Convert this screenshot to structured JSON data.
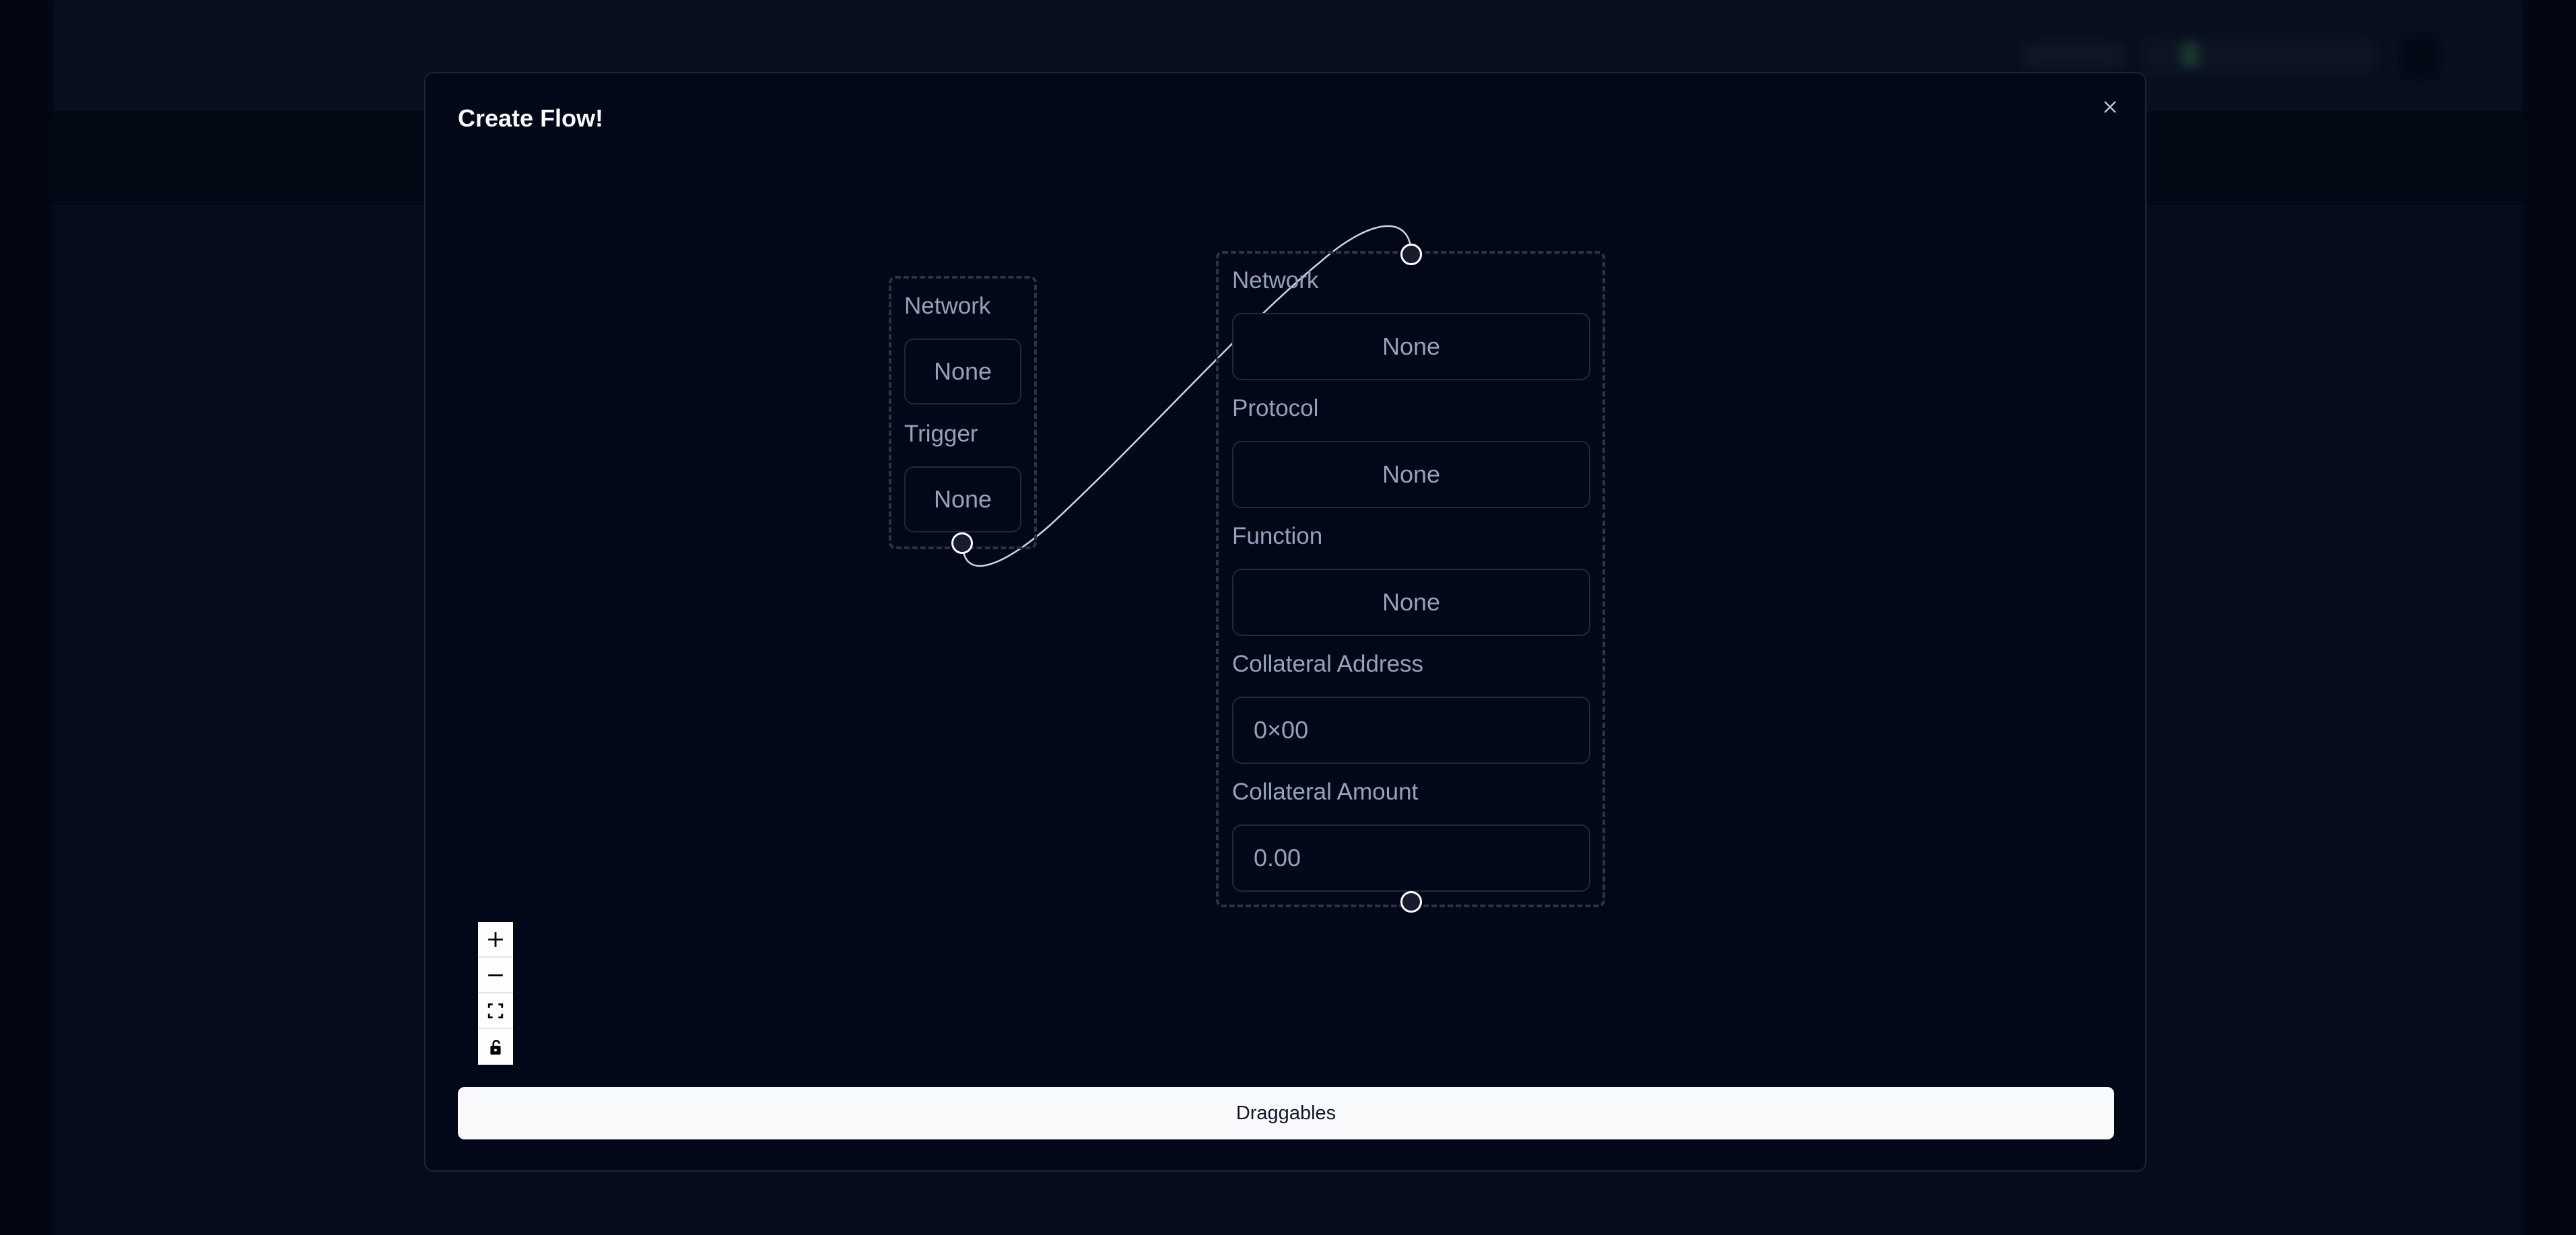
{
  "modal": {
    "title": "Create Flow!",
    "close_icon": "close-icon"
  },
  "nodes": [
    {
      "id": "trigger-node",
      "fields": [
        {
          "label": "Network",
          "value": "None",
          "kind": "select"
        },
        {
          "label": "Trigger",
          "value": "None",
          "kind": "select"
        }
      ]
    },
    {
      "id": "action-node",
      "fields": [
        {
          "label": "Network",
          "value": "None",
          "kind": "select"
        },
        {
          "label": "Protocol",
          "value": "None",
          "kind": "select"
        },
        {
          "label": "Function",
          "value": "None",
          "kind": "select"
        },
        {
          "label": "Collateral Address",
          "value": "0×00",
          "kind": "input"
        },
        {
          "label": "Collateral Amount",
          "value": "0.00",
          "kind": "input"
        }
      ]
    }
  ],
  "edges": [
    {
      "from": "trigger-node.bottom-handle",
      "to": "action-node.top-handle"
    }
  ],
  "controls": [
    {
      "name": "zoom-in",
      "icon": "plus-icon"
    },
    {
      "name": "zoom-out",
      "icon": "minus-icon"
    },
    {
      "name": "fit-view",
      "icon": "fit-view-icon"
    },
    {
      "name": "toggle-interactivity",
      "icon": "unlock-icon"
    }
  ],
  "footer": {
    "draggables_label": "Draggables"
  },
  "colors": {
    "modal_bg": "#020817",
    "text_muted": "#94a3b8",
    "button_bg": "#f8fafc",
    "edge": "#d1d5db"
  }
}
